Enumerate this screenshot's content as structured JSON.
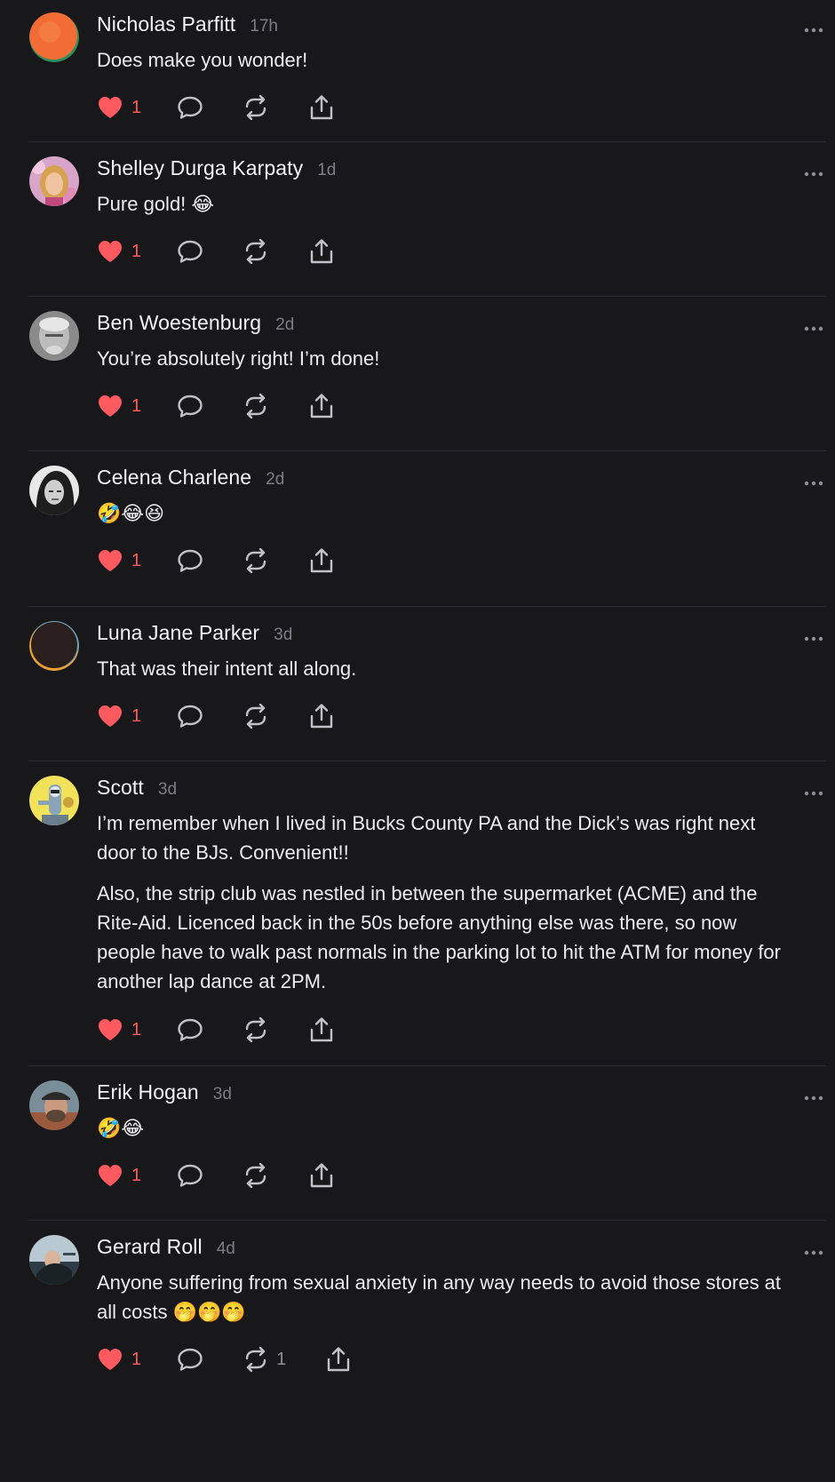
{
  "comments": [
    {
      "author": "Nicholas Parfitt",
      "time": "17h",
      "text": [
        "Does make you wonder!"
      ],
      "likes": "1",
      "reposts": "",
      "avatar": "orange-circle-avatar"
    },
    {
      "author": "Shelley Durga Karpaty",
      "time": "1d",
      "text": [
        "Pure gold! 😂"
      ],
      "likes": "1",
      "reposts": "",
      "avatar": "photo-avatar"
    },
    {
      "author": "Ben Woestenburg",
      "time": "2d",
      "text": [
        "You’re absolutely right! I’m done!"
      ],
      "likes": "1",
      "reposts": "",
      "avatar": "photo-avatar"
    },
    {
      "author": "Celena Charlene",
      "time": "2d",
      "text": [
        "🤣😂😆"
      ],
      "likes": "1",
      "reposts": "",
      "avatar": "photo-avatar"
    },
    {
      "author": "Luna Jane Parker",
      "time": "3d",
      "text": [
        "That was their intent all along."
      ],
      "likes": "1",
      "reposts": "",
      "avatar": "dark-circle-avatar"
    },
    {
      "author": "Scott",
      "time": "3d",
      "text": [
        "I’m remember when I lived in Bucks County PA and the Dick’s was right next door to the BJs. Convenient!!",
        "Also, the strip club was nestled in between the supermarket (ACME) and the Rite-Aid. Licenced back in the 50s before anything else was there, so now people have to walk past normals in the parking lot to hit the ATM for money for another lap dance at 2PM."
      ],
      "likes": "1",
      "reposts": "",
      "avatar": "cartoon-avatar"
    },
    {
      "author": "Erik Hogan",
      "time": "3d",
      "text": [
        "🤣😂"
      ],
      "likes": "1",
      "reposts": "",
      "avatar": "photo-avatar"
    },
    {
      "author": "Gerard Roll",
      "time": "4d",
      "text": [
        "Anyone suffering from sexual anxiety in any way needs to avoid those stores at all costs 🤭🤭🤭"
      ],
      "likes": "1",
      "reposts": "1",
      "avatar": "photo-avatar"
    }
  ],
  "colors": {
    "background": "#18181b",
    "like": "#ff5a5f",
    "muted": "#7d7d83",
    "divider": "#2e2e32"
  },
  "icons": {
    "like": "heart-icon",
    "reply": "speech-bubble-icon",
    "repost": "repost-arrows-icon",
    "share": "share-upload-icon",
    "more": "ellipsis-icon"
  }
}
